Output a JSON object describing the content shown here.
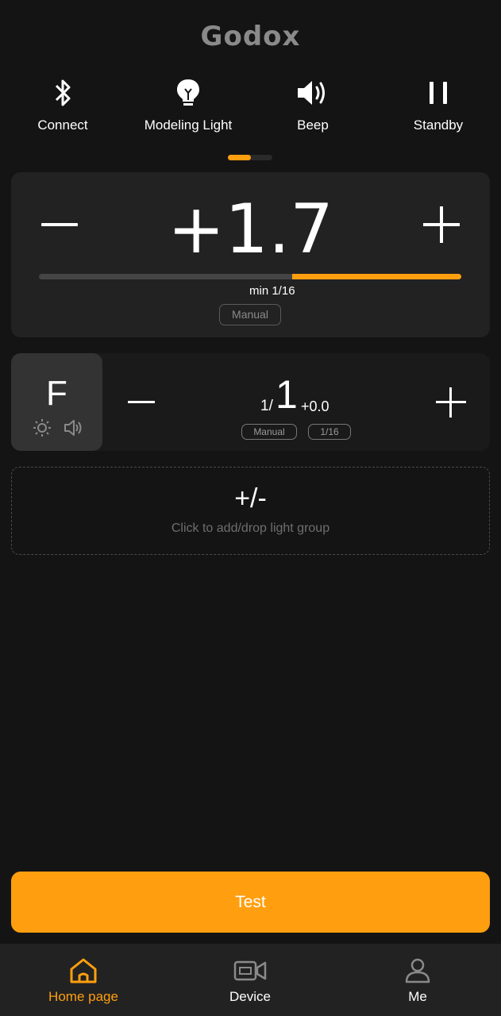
{
  "brand": {
    "logo_text": "Godox"
  },
  "quick_actions": [
    {
      "label": "Connect",
      "icon": "bluetooth-icon"
    },
    {
      "label": "Modeling Light",
      "icon": "bulb-icon"
    },
    {
      "label": "Beep",
      "icon": "speaker-icon"
    },
    {
      "label": "Standby",
      "icon": "pause-icon"
    }
  ],
  "pager": {
    "pages": 2,
    "current": 1
  },
  "master": {
    "value": "+1.7",
    "min_label": "min 1/16",
    "mode": "Manual",
    "level_fraction_start": 0.6,
    "level_fraction_end": 1.0
  },
  "group": {
    "letter": "F",
    "fraction_prefix": "1/",
    "fraction_value": "1",
    "ev": "+0.0",
    "mode": "Manual",
    "ratio": "1/16"
  },
  "add_group": {
    "title": "+/-",
    "hint": "Click to add/drop light group"
  },
  "test_button": {
    "label": "Test"
  },
  "nav": {
    "items": [
      {
        "label": "Home page",
        "icon": "home-icon",
        "active": true
      },
      {
        "label": "Device",
        "icon": "camera-icon",
        "active": false
      },
      {
        "label": "Me",
        "icon": "user-icon",
        "active": false
      }
    ]
  },
  "colors": {
    "accent": "#ff9f0f",
    "background": "#141414",
    "card": "#222222"
  }
}
